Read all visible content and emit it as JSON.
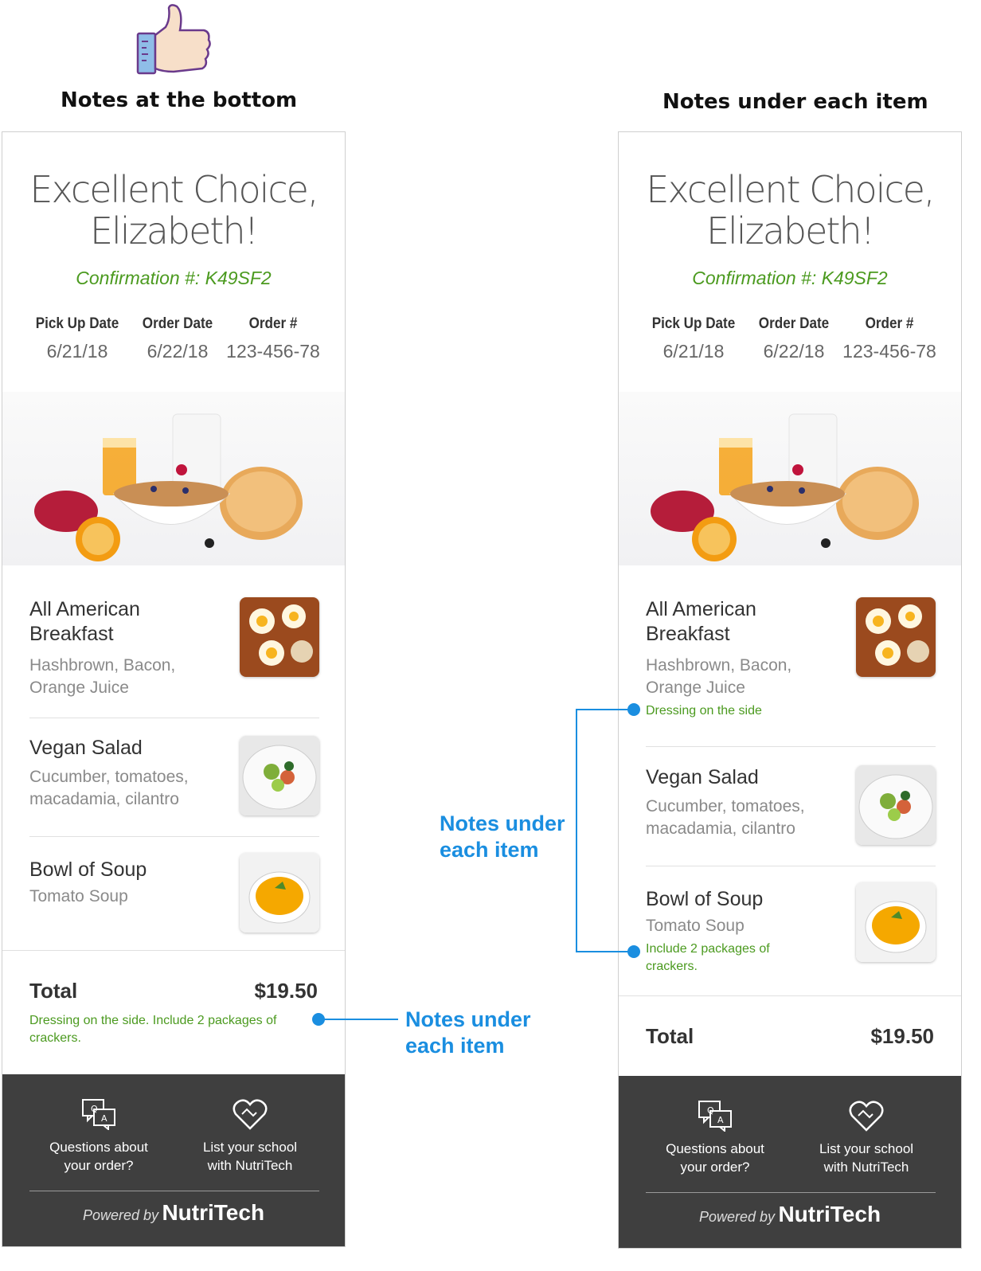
{
  "headings": {
    "left": "Notes at the bottom",
    "right": "Notes under each item"
  },
  "receipt": {
    "greeting_line1": "Excellent Choice,",
    "greeting_line2": "Elizabeth!",
    "confirmation": "Confirmation #: K49SF2",
    "meta": [
      {
        "label": "Pick Up Date",
        "value": "6/21/18"
      },
      {
        "label": "Order Date",
        "value": "6/22/18"
      },
      {
        "label": "Order #",
        "value": "123-456-78"
      }
    ],
    "items": [
      {
        "name_line1": "All American",
        "name_line2": "Breakfast",
        "desc_line1": "Hashbrown, Bacon,",
        "desc_line2": "Orange Juice"
      },
      {
        "name_line1": "Vegan Salad",
        "desc_line1": "Cucumber, tomatoes,",
        "desc_line2": "macadamia, cilantro"
      },
      {
        "name_line1": "Bowl of Soup",
        "desc_line1": "Tomato Soup"
      }
    ],
    "total_label": "Total",
    "total_value": "$19.50",
    "footer": {
      "questions_line1": "Questions about",
      "questions_line2": "your order?",
      "list_line1": "List your school",
      "list_line2": "with NutriTech",
      "powered_by": "Powered by",
      "brand": "NutriTech"
    }
  },
  "left_panel": {
    "bottom_note_line1": "Dressing on the side. Include 2 packages of",
    "bottom_note_line2": "crackers."
  },
  "right_panel": {
    "item1_note": "Dressing on the side",
    "item3_note_line1": "Include 2 packages of",
    "item3_note_line2": "crackers."
  },
  "callouts": {
    "line1": "Notes under",
    "line2": "each item"
  },
  "icons": [
    "thumbs-up-icon",
    "qa-chat-icon",
    "handshake-heart-icon"
  ],
  "colors": {
    "note_green": "#4b9a1f",
    "callout_blue": "#1a8ee0",
    "footer_bg": "#3f3f3f"
  }
}
